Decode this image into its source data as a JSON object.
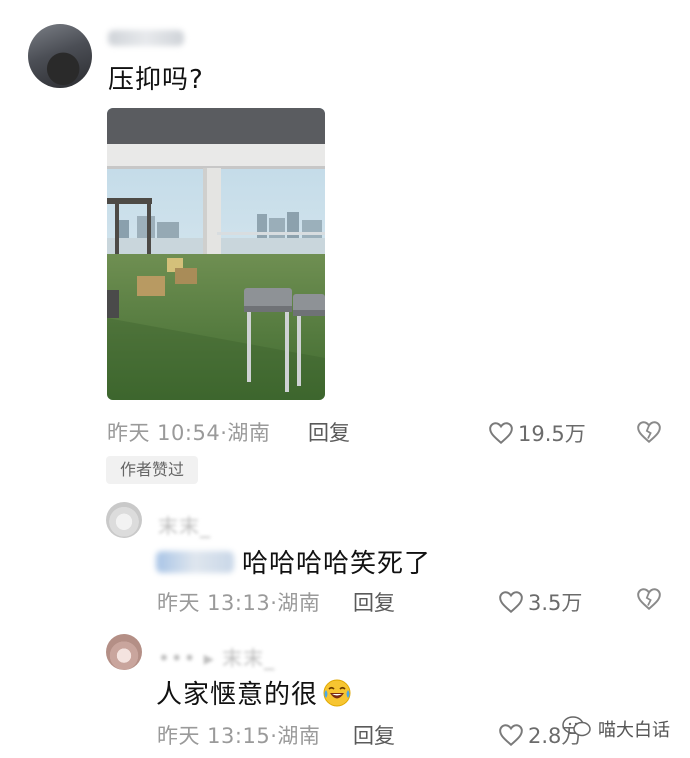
{
  "comment": {
    "username": "••••• ••",
    "text": "压抑吗?",
    "time": "昨天 10:54",
    "location": "湖南",
    "reply_label": "回复",
    "likes": "19.5万",
    "author_badge": "作者赞过"
  },
  "replies": [
    {
      "username": "末末_",
      "mention": "•••",
      "text": "哈哈哈哈笑死了",
      "time": "昨天 13:13",
      "location": "湖南",
      "reply_label": "回复",
      "likes": "3.5万"
    },
    {
      "username": "••• ▸ 末末_",
      "text": "人家惬意的很",
      "time": "昨天 13:15",
      "location": "湖南",
      "reply_label": "回复",
      "likes": "2.8万"
    }
  ],
  "watermark": {
    "text": "喵大白话"
  },
  "icons": {
    "like": "heart-outline-icon",
    "dislike": "broken-heart-icon",
    "emoji": "laughing-crying-emoji-icon",
    "watermark": "wechat-icon"
  },
  "colors": {
    "meta": "#9a9a9a",
    "text": "#111111",
    "badge_bg": "#f1f1f1"
  }
}
